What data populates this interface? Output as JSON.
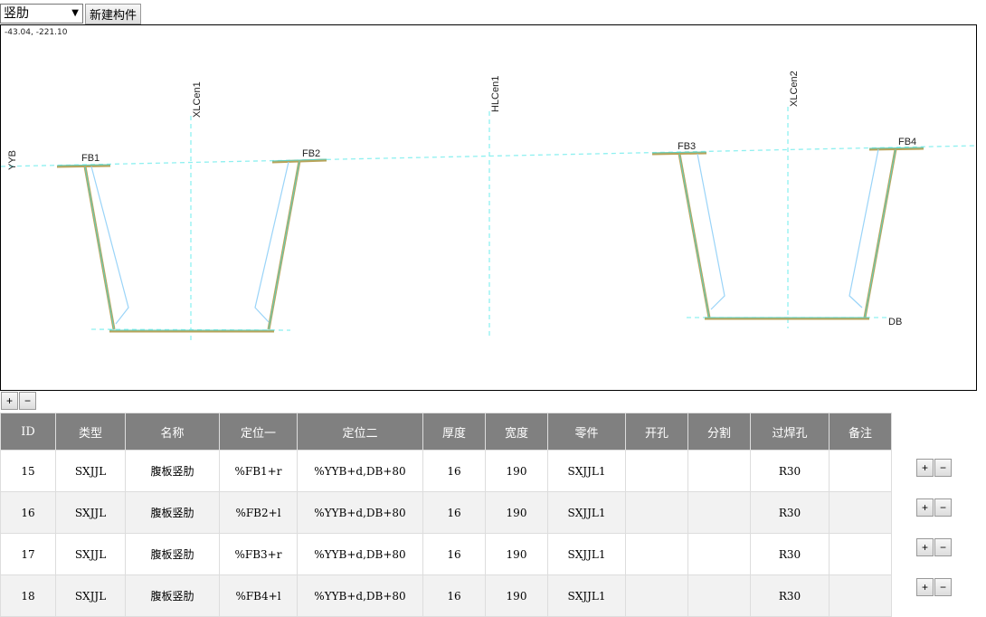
{
  "toolbar": {
    "type_select": "竖肋",
    "new_button": "新建构件"
  },
  "canvas": {
    "coords": "-43.04, -221.10",
    "labels": {
      "yyb": "YYB",
      "xlcen1": "XLCen1",
      "hlcen1": "HLCen1",
      "xlcen2": "XLCen2",
      "fb1": "FB1",
      "fb2": "FB2",
      "fb3": "FB3",
      "fb4": "FB4",
      "db": "DB"
    }
  },
  "zoom": {
    "plus": "+",
    "minus": "−"
  },
  "table": {
    "headers": [
      "ID",
      "类型",
      "名称",
      "定位一",
      "定位二",
      "厚度",
      "宽度",
      "零件",
      "开孔",
      "分割",
      "过焊孔",
      "备注"
    ],
    "rows": [
      [
        "15",
        "SXJJL",
        "腹板竖肋",
        "%FB1+r",
        "%YYB+d,DB+80",
        "16",
        "190",
        "SXJJL1",
        "",
        "",
        "R30",
        ""
      ],
      [
        "16",
        "SXJJL",
        "腹板竖肋",
        "%FB2+l",
        "%YYB+d,DB+80",
        "16",
        "190",
        "SXJJL1",
        "",
        "",
        "R30",
        ""
      ],
      [
        "17",
        "SXJJL",
        "腹板竖肋",
        "%FB3+r",
        "%YYB+d,DB+80",
        "16",
        "190",
        "SXJJL1",
        "",
        "",
        "R30",
        ""
      ],
      [
        "18",
        "SXJJL",
        "腹板竖肋",
        "%FB4+l",
        "%YYB+d,DB+80",
        "16",
        "190",
        "SXJJL1",
        "",
        "",
        "R30",
        ""
      ]
    ],
    "row_add": "+",
    "row_remove": "−"
  }
}
